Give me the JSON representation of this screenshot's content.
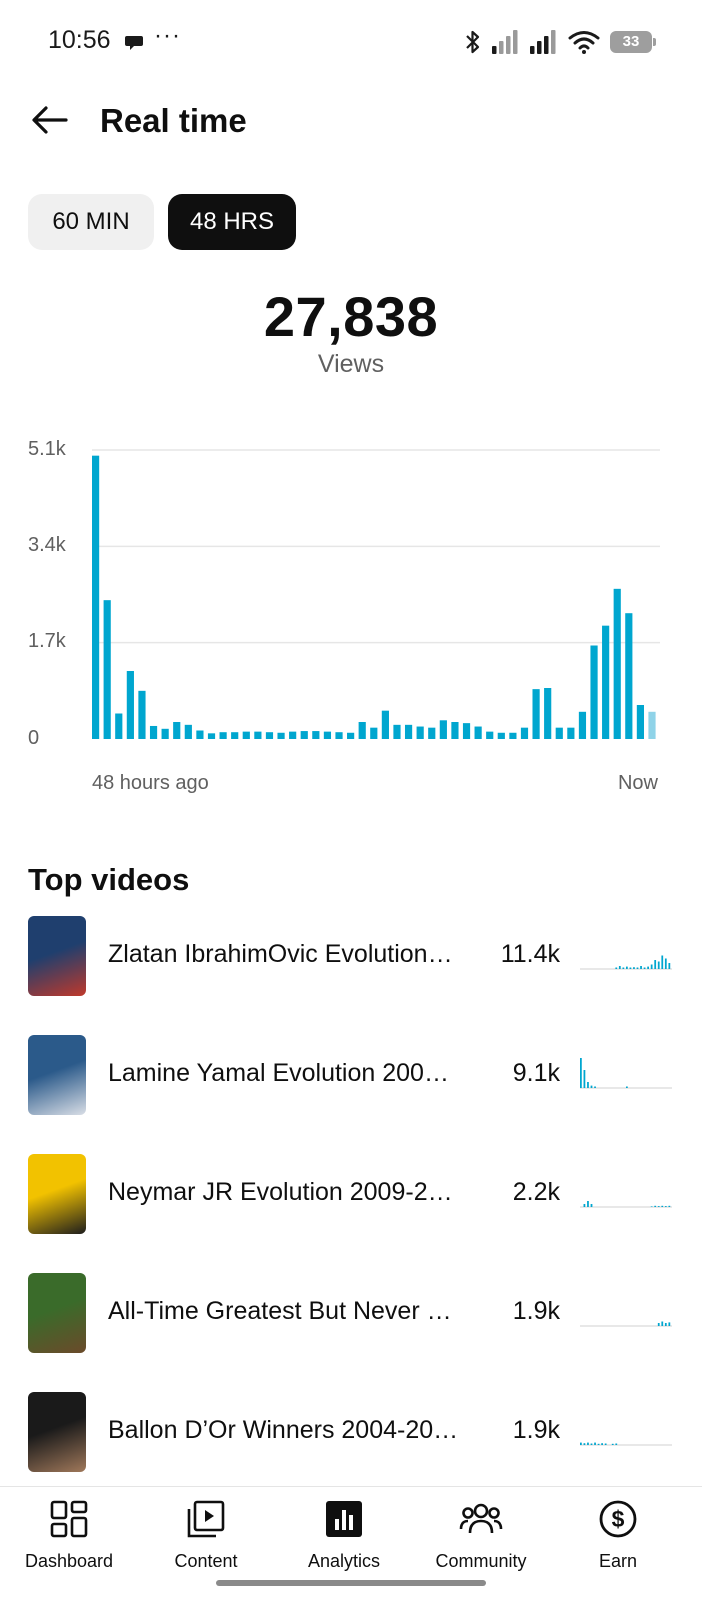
{
  "status_bar": {
    "time": "10:56",
    "battery": "33"
  },
  "header": {
    "title": "Real time"
  },
  "tabs": [
    {
      "label": "60 MIN",
      "selected": false
    },
    {
      "label": "48 HRS",
      "selected": true
    }
  ],
  "summary": {
    "total": "27,838",
    "label": "Views"
  },
  "chart_data": {
    "type": "bar",
    "y_ticks": [
      "5.1k",
      "3.4k",
      "1.7k",
      "0"
    ],
    "ylim": [
      0,
      5100
    ],
    "x_start_label": "48 hours ago",
    "x_end_label": "Now",
    "grid": true,
    "color": "#00a6cf",
    "highlight_color": "#8fd3e8",
    "values": [
      5000,
      2450,
      450,
      1200,
      850,
      230,
      180,
      300,
      250,
      150,
      100,
      120,
      120,
      130,
      130,
      120,
      110,
      130,
      140,
      140,
      130,
      120,
      110,
      300,
      200,
      500,
      250,
      250,
      220,
      200,
      330,
      300,
      280,
      220,
      130,
      110,
      110,
      200,
      880,
      900,
      200,
      200,
      480,
      1650,
      2000,
      2650,
      2220,
      600,
      480
    ]
  },
  "top_videos": {
    "title": "Top videos",
    "items": [
      {
        "title": "Zlatan IbrahimOvic Evolution…",
        "views": "11.4k",
        "spark": [
          0,
          0,
          0,
          0,
          0,
          0,
          0,
          0,
          0,
          0,
          0.05,
          0.1,
          0.05,
          0.08,
          0.05,
          0.06,
          0.05,
          0.1,
          0.05,
          0.08,
          0.15,
          0.3,
          0.25,
          0.45,
          0.35,
          0.2
        ],
        "thumb": [
          "#1f3f6e",
          "#c0392b"
        ]
      },
      {
        "title": "Lamine Yamal Evolution 2007…",
        "views": "9.1k",
        "spark": [
          1,
          0.6,
          0.2,
          0.08,
          0.05,
          0,
          0,
          0,
          0,
          0,
          0,
          0,
          0,
          0.05,
          0,
          0,
          0,
          0,
          0,
          0,
          0,
          0,
          0,
          0,
          0,
          0
        ],
        "thumb": [
          "#2b5a8a",
          "#d9dee6"
        ]
      },
      {
        "title": "Neymar JR Evolution 2009-20…",
        "views": "2.2k",
        "spark": [
          0,
          0.1,
          0.2,
          0.1,
          0,
          0,
          0,
          0,
          0,
          0,
          0,
          0,
          0,
          0,
          0,
          0,
          0,
          0,
          0,
          0,
          0.02,
          0.04,
          0.03,
          0.04,
          0.03,
          0.04
        ],
        "thumb": [
          "#f2c200",
          "#1d1d1d"
        ]
      },
      {
        "title": "All-Time Greatest But Never …",
        "views": "1.9k",
        "spark": [
          0,
          0,
          0,
          0,
          0,
          0,
          0,
          0,
          0,
          0,
          0,
          0,
          0,
          0,
          0,
          0,
          0,
          0,
          0,
          0,
          0,
          0,
          0.1,
          0.15,
          0.1,
          0.12
        ],
        "thumb": [
          "#3a6b2a",
          "#6b4a2a"
        ]
      },
      {
        "title": "Ballon D’Or Winners 2004-20…",
        "views": "1.9k",
        "spark": [
          0.08,
          0.06,
          0.08,
          0.05,
          0.08,
          0.04,
          0.06,
          0.05,
          0,
          0.04,
          0.05,
          0,
          0,
          0,
          0,
          0,
          0,
          0,
          0,
          0,
          0,
          0,
          0,
          0,
          0,
          0
        ],
        "thumb": [
          "#1a1a1a",
          "#a0785a"
        ]
      }
    ]
  },
  "bottom_nav": [
    {
      "label": "Dashboard",
      "icon": "dashboard-icon"
    },
    {
      "label": "Content",
      "icon": "content-icon"
    },
    {
      "label": "Analytics",
      "icon": "analytics-icon",
      "selected": true
    },
    {
      "label": "Community",
      "icon": "community-icon"
    },
    {
      "label": "Earn",
      "icon": "earn-icon"
    }
  ]
}
